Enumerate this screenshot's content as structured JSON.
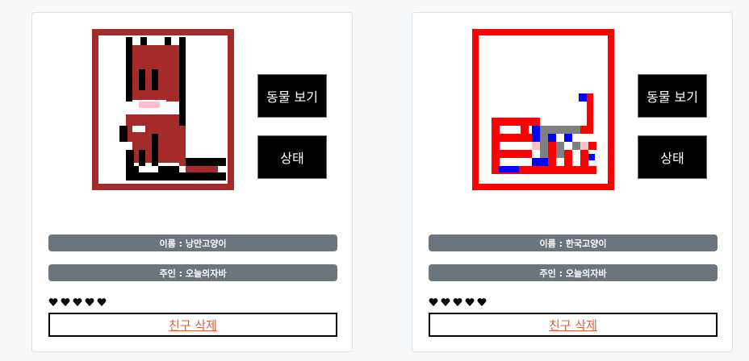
{
  "cards": [
    {
      "pet_image": "pixel-cat-brown-icon",
      "buttons": {
        "view": "동물 보기",
        "status": "상태"
      },
      "name_label": "이름 : 낭만고양이",
      "owner_label": "주인 : 오늘의자바",
      "hearts": 5,
      "delete_label": "친구 삭제"
    },
    {
      "pet_image": "pixel-cat-red-icon",
      "buttons": {
        "view": "동물 보기",
        "status": "상태"
      },
      "name_label": "이름 : 한국고양이",
      "owner_label": "주인 : 오늘의자바",
      "hearts": 5,
      "delete_label": "친구 삭제"
    }
  ],
  "colors": {
    "badge_bg": "#6c757d",
    "delete_text": "#d9603b",
    "frame_brown": "#a52a2a",
    "frame_red": "#ff0000"
  }
}
